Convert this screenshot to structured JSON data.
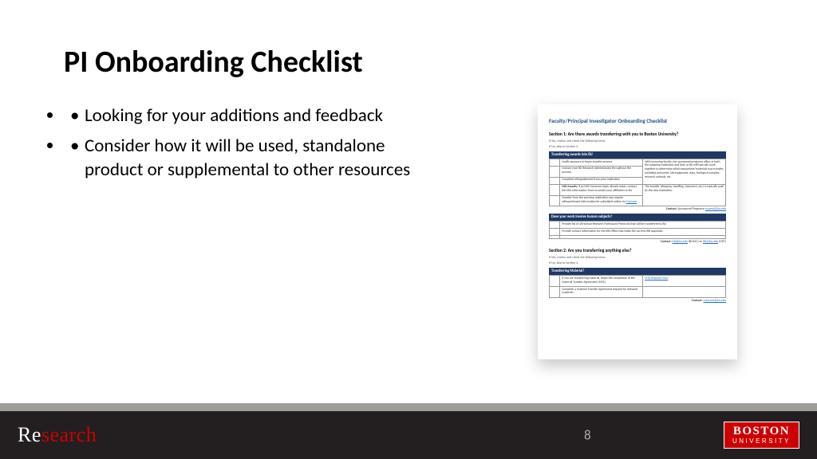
{
  "title": "PI Onboarding Checklist",
  "bullets": [
    "Looking for your additions and feedback",
    "Consider how it will be used, standalone product or supplemental to other resources"
  ],
  "doc": {
    "title": "Faculty/Principal Investigator Onboarding Checklist",
    "section1": "Section 1: Are there awards transferring with you to Boston University?",
    "yes1": "If Yes, review and check the following items.",
    "no1": "If No, skip to Section 2.",
    "bar1": "Transferring awards into BU",
    "r1a": "Notify sponsors to begin transfer process",
    "r1a_right": "With incoming faculty, the sponsored programs office at both the outgoing institution and here at BU will typically work together to determine which equipment/materials may transfer, including personnel, lab equipment, data, biological samples, research animals, etc.",
    "r1b": "Contact your BU Research Administrator throughout the process",
    "r1c": "Complete relinquishment from prior institution",
    "r1d_label": "NIH Awards:",
    "r1d": " If an NIH Commons login already exists, contact the ERA Information Team to switch your affiliation to BU",
    "r1d_right": "The transfer (shipping, handling, insurance, etc.) is typically paid by the new institution.",
    "r1e": "Transfer from the previous institution may require relinquishment information be submitted online via ",
    "r1e_link": "FastLane",
    "contact1_label": "Contact:",
    "contact1_text": " Sponsored Programs ",
    "contact1_link": "ospera@bu.edu",
    "bar2": "Does your work involve human subjects?",
    "r2a": "Provide list of all Human Research Participant Protocols that will be transferred to BU",
    "r2b": "Provide contact information for the IRB Office that holds the current IRB approvals",
    "contact2_label": "Contact:",
    "contact2_link1": "irb@bu.edu",
    "contact2_paren1": " (BUMC) or ",
    "contact2_link2": "irb@bu.edu",
    "contact2_paren2": " (CRC)",
    "section2": "Section 2: Are you transferring anything else?",
    "yes2": "If Yes, review and check the following items.",
    "no2": "If No, skip to Section 3.",
    "bar3": "Transferring Material?",
    "r3a": "If you are transferring material, begin the completion of the Material Transfer Agreement (MTA)",
    "r3a_link": "MTA Request Form",
    "r3b": "Complete a Material Transfer Agreement request for released materials.",
    "contact3_label": "Contact:",
    "contact3_link": "mtacore@bu.edu"
  },
  "footer": {
    "logo_re": "Re",
    "logo_search": "search",
    "page": "8",
    "bu_boston": "BOSTON",
    "bu_univ": "UNIVERSITY"
  }
}
